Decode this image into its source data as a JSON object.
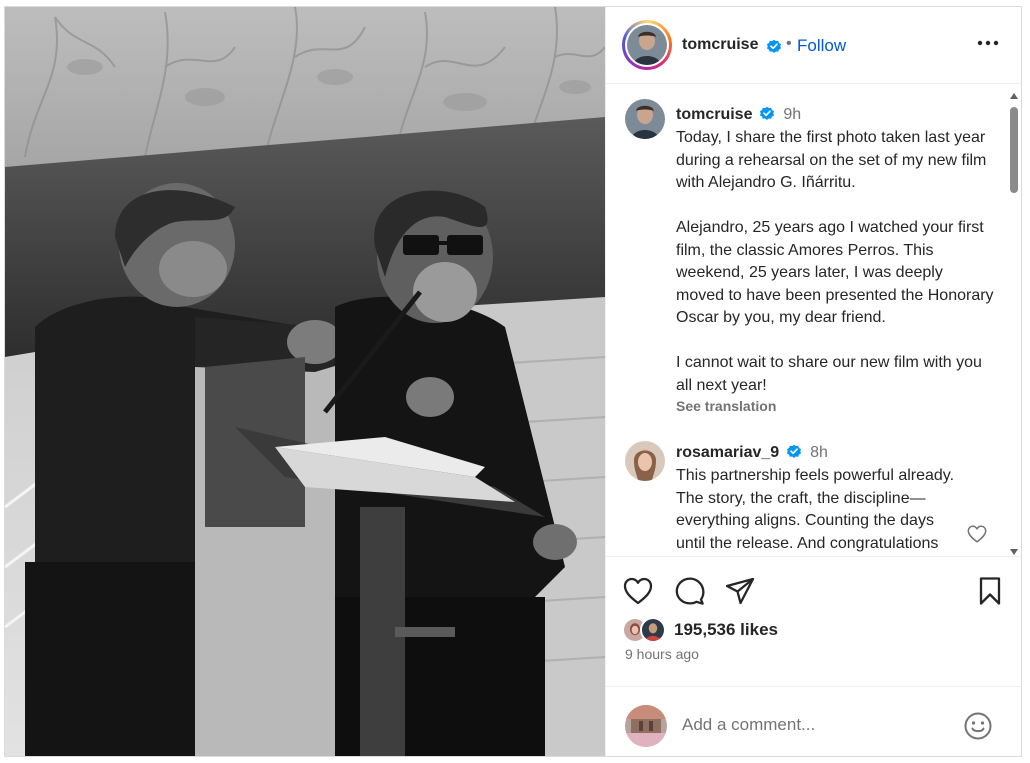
{
  "post": {
    "username": "tomcruise",
    "follow_label": "Follow",
    "dot": "•"
  },
  "caption": {
    "username": "tomcruise",
    "time": "9h",
    "text": "Today, I share the first photo taken last year during a rehearsal on the set of my new film with Alejandro G. Iñárritu.\n\nAlejandro, 25 years ago I watched your first film, the classic Amores Perros. This weekend, 25 years later, I was deeply moved to have been presented the Honorary Oscar by you, my dear friend.\n\nI cannot wait to share our new film with you all next year!",
    "see_translation": "See translation"
  },
  "comments": [
    {
      "username": "rosamariav_9",
      "time": "8h",
      "text": "This partnership feels powerful already. The story, the craft, the discipline—everything aligns. Counting the days until the release. And congratulations"
    }
  ],
  "stats": {
    "likes": "195,536 likes",
    "time_ago": "9 hours ago"
  },
  "composer": {
    "placeholder": "Add a comment..."
  },
  "icons": {
    "more": "more-options-icon",
    "verified": "verified-badge-icon",
    "like": "heart-icon",
    "comment": "comment-bubble-icon",
    "share": "share-icon",
    "save": "bookmark-icon",
    "emoji": "emoji-icon"
  },
  "colors": {
    "accent": "#0059d8",
    "verified": "#0095f6",
    "muted": "#737373",
    "text": "#262626",
    "divider": "#efefef"
  }
}
